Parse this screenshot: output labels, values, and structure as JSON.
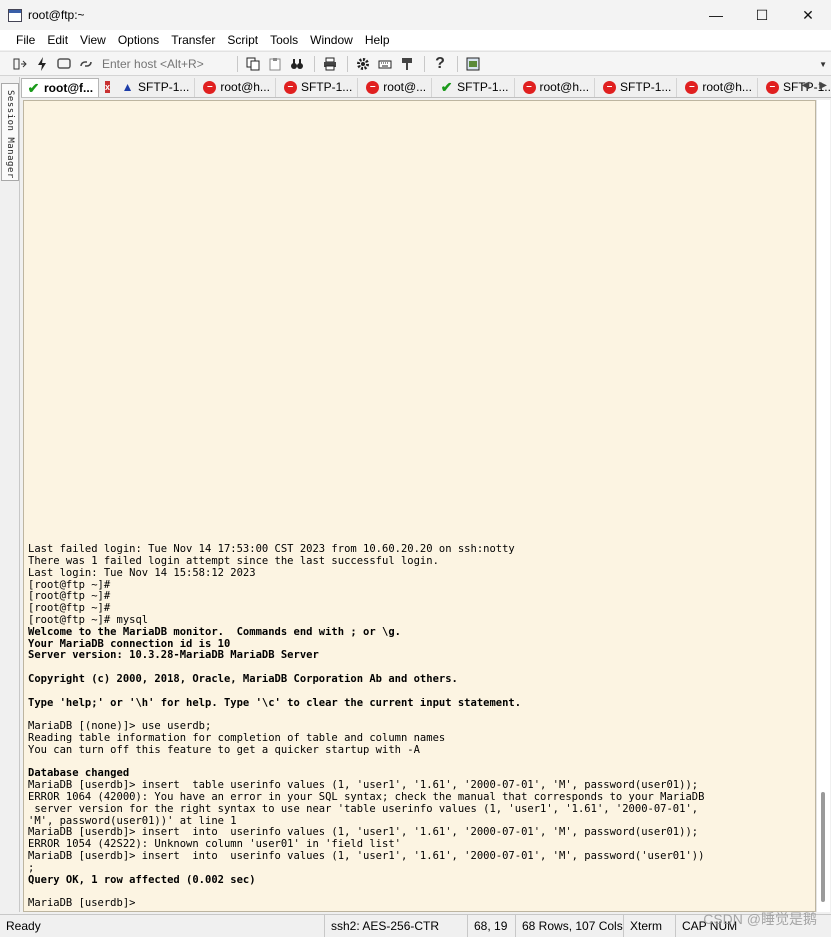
{
  "window": {
    "title": "root@ftp:~",
    "minimize": "—",
    "maximize": "☐",
    "close": "✕"
  },
  "menu": [
    "File",
    "Edit",
    "View",
    "Options",
    "Transfer",
    "Script",
    "Tools",
    "Window",
    "Help"
  ],
  "toolbar": {
    "host_placeholder": "Enter host <Alt+R>",
    "help_glyph": "?"
  },
  "side": {
    "session_manager": "Session Manager"
  },
  "tabs": [
    {
      "label": "root@f...",
      "status": "connected",
      "active": true
    },
    {
      "label": "SFTP-1...",
      "status": "warning"
    },
    {
      "label": "root@h...",
      "status": "disconnected"
    },
    {
      "label": "SFTP-1...",
      "status": "disconnected"
    },
    {
      "label": "root@...",
      "status": "disconnected"
    },
    {
      "label": "SFTP-1...",
      "status": "connected"
    },
    {
      "label": "root@h...",
      "status": "disconnected"
    },
    {
      "label": "SFTP-1...",
      "status": "disconnected"
    },
    {
      "label": "root@h...",
      "status": "disconnected"
    },
    {
      "label": "SFTP-1...",
      "status": "disconnected"
    }
  ],
  "terminal": {
    "lines": [
      {
        "t": "Last failed login: Tue Nov 14 17:53:00 CST 2023 from 10.60.20.20 on ssh:notty",
        "b": false
      },
      {
        "t": "There was 1 failed login attempt since the last successful login.",
        "b": false
      },
      {
        "t": "Last login: Tue Nov 14 15:58:12 2023",
        "b": false
      },
      {
        "t": "[root@ftp ~]#",
        "b": false
      },
      {
        "t": "[root@ftp ~]#",
        "b": false
      },
      {
        "t": "[root@ftp ~]#",
        "b": false
      },
      {
        "t": "[root@ftp ~]# mysql",
        "b": false
      },
      {
        "t": "Welcome to the MariaDB monitor.  Commands end with ; or \\g.",
        "b": true
      },
      {
        "t": "Your MariaDB connection id is 10",
        "b": true
      },
      {
        "t": "Server version: 10.3.28-MariaDB MariaDB Server",
        "b": true
      },
      {
        "t": "",
        "b": false
      },
      {
        "t": "Copyright (c) 2000, 2018, Oracle, MariaDB Corporation Ab and others.",
        "b": true
      },
      {
        "t": "",
        "b": false
      },
      {
        "t": "Type 'help;' or '\\h' for help. Type '\\c' to clear the current input statement.",
        "b": true
      },
      {
        "t": "",
        "b": false
      },
      {
        "t": "MariaDB [(none)]> use userdb;",
        "b": false
      },
      {
        "t": "Reading table information for completion of table and column names",
        "b": false
      },
      {
        "t": "You can turn off this feature to get a quicker startup with -A",
        "b": false
      },
      {
        "t": "",
        "b": false
      },
      {
        "t": "Database changed",
        "b": true
      },
      {
        "t": "MariaDB [userdb]> insert  table userinfo values (1, 'user1', '1.61', '2000-07-01', 'M', password(user01));",
        "b": false
      },
      {
        "t": "ERROR 1064 (42000): You have an error in your SQL syntax; check the manual that corresponds to your MariaDB",
        "b": false
      },
      {
        "t": " server version for the right syntax to use near 'table userinfo values (1, 'user1', '1.61', '2000-07-01',",
        "b": false
      },
      {
        "t": "'M', password(user01))' at line 1",
        "b": false
      },
      {
        "t": "MariaDB [userdb]> insert  into  userinfo values (1, 'user1', '1.61', '2000-07-01', 'M', password(user01));",
        "b": false
      },
      {
        "t": "ERROR 1054 (42S22): Unknown column 'user01' in 'field list'",
        "b": false
      },
      {
        "t": "MariaDB [userdb]> insert  into  userinfo values (1, 'user1', '1.61', '2000-07-01', 'M', password('user01'))",
        "b": false
      },
      {
        "t": ";",
        "b": false
      },
      {
        "t": "Query OK, 1 row affected (0.002 sec)",
        "b": true
      },
      {
        "t": "",
        "b": false
      },
      {
        "t": "MariaDB [userdb]>",
        "b": false
      }
    ]
  },
  "status": {
    "ready": "Ready",
    "cipher": "ssh2: AES-256-CTR",
    "cursor": "68,  19",
    "size": "68 Rows, 107 Cols",
    "emulation": "Xterm",
    "keys": "CAP  NUM"
  },
  "watermark": "CSDN @睡觉是鹅",
  "colors": {
    "terminal_bg": "#fcf4e2",
    "ok": "#1a9a1a",
    "error": "#e02020",
    "warning": "#1d3da8"
  }
}
